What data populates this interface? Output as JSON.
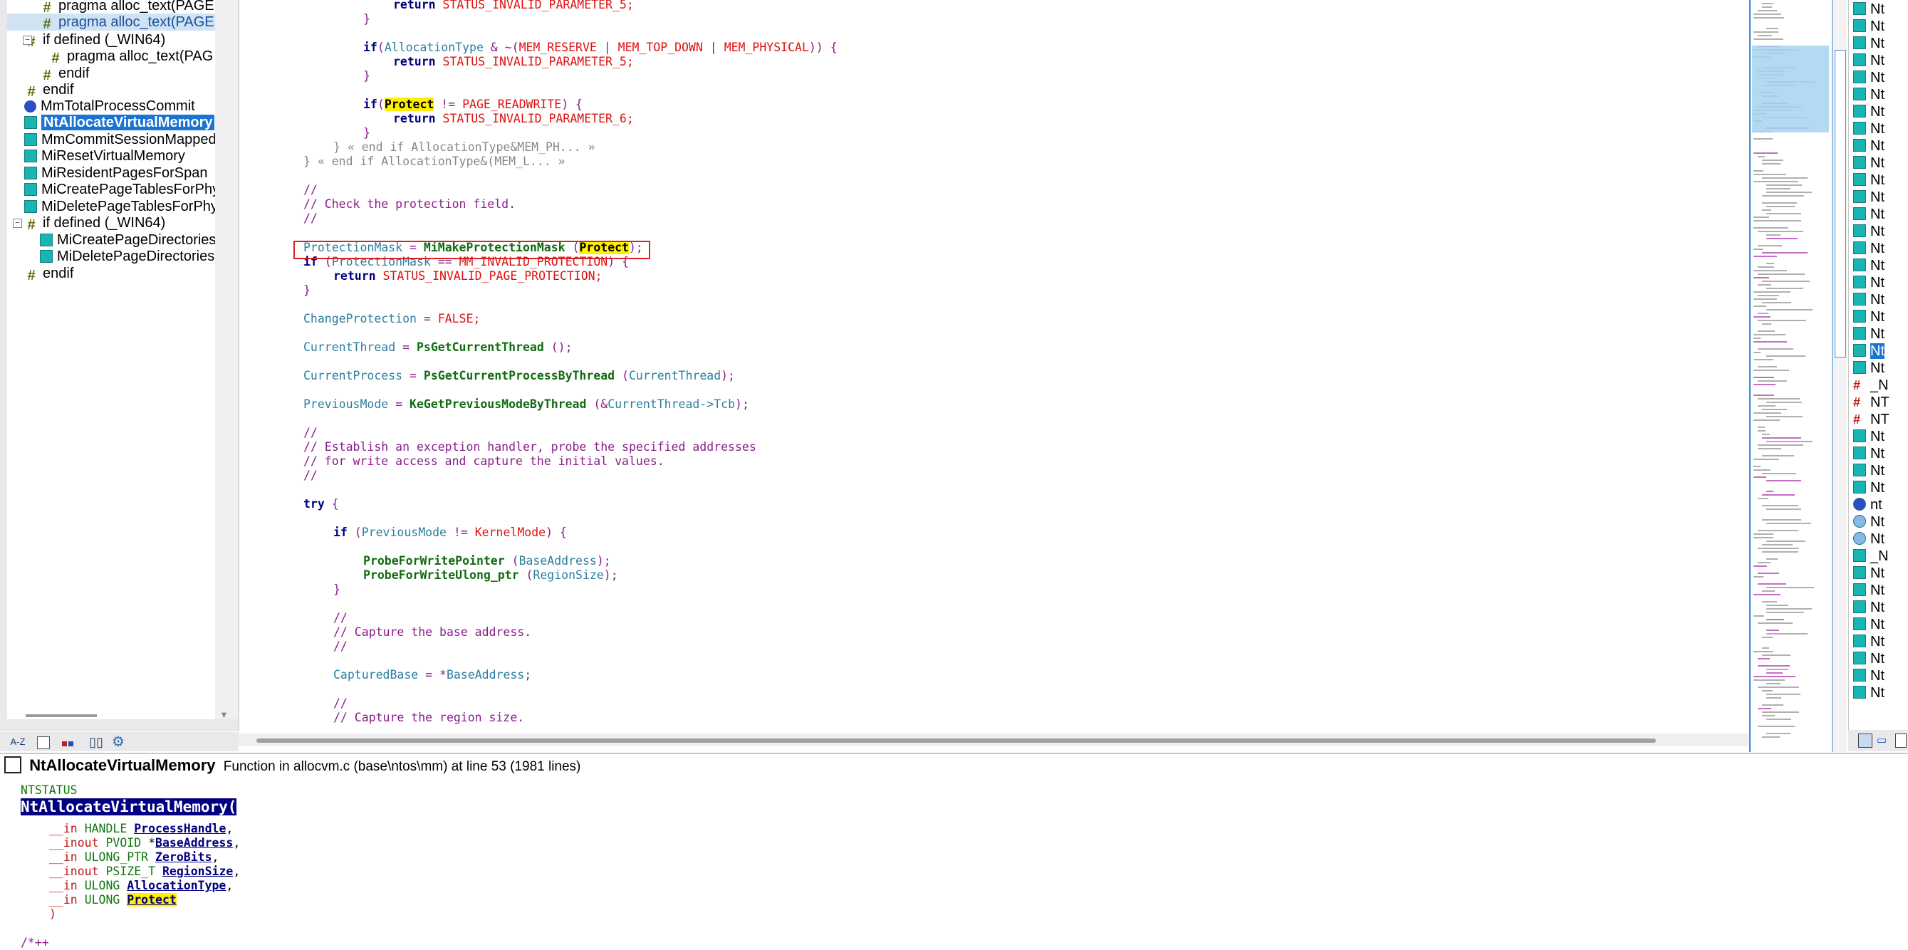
{
  "tree": {
    "items": [
      {
        "label": "pragma alloc_text(PAGE,M",
        "icon": "hash-icon",
        "expander": ""
      },
      {
        "label": "pragma alloc_text(PAGELK",
        "icon": "hash-icon",
        "expander": ""
      },
      {
        "label": "if defined (_WIN64)",
        "icon": "hash-icon",
        "expander": "−"
      },
      {
        "label": "pragma alloc_text(PAG",
        "icon": "hash-icon",
        "expander": ""
      },
      {
        "label": "endif",
        "icon": "hash-icon",
        "expander": ""
      },
      {
        "label": "endif",
        "icon": "hash-icon",
        "expander": ""
      },
      {
        "label": "MmTotalProcessCommit",
        "icon": "variable-icon",
        "expander": ""
      },
      {
        "label": "NtAllocateVirtualMemory",
        "icon": "function-icon",
        "expander": ""
      },
      {
        "label": "MmCommitSessionMappedV",
        "icon": "function-icon",
        "expander": ""
      },
      {
        "label": "MiResetVirtualMemory",
        "icon": "function-icon",
        "expander": ""
      },
      {
        "label": "MiResidentPagesForSpan",
        "icon": "function-icon",
        "expander": ""
      },
      {
        "label": "MiCreatePageTablesForPhys",
        "icon": "function-icon",
        "expander": ""
      },
      {
        "label": "MiDeletePageTablesForPhys",
        "icon": "function-icon",
        "expander": ""
      },
      {
        "label": "if defined (_WIN64)",
        "icon": "hash-icon",
        "expander": "−"
      },
      {
        "label": "MiCreatePageDirectoriesF",
        "icon": "function-icon",
        "expander": ""
      },
      {
        "label": "MiDeletePageDirectoriesF",
        "icon": "function-icon",
        "expander": ""
      },
      {
        "label": "endif",
        "icon": "hash-icon",
        "expander": ""
      }
    ],
    "toolbar": [
      "A-Z",
      "list",
      "categories",
      "book",
      "settings"
    ]
  },
  "code": {
    "lines": {
      "l0_return": "return",
      "l0_status": "STATUS_INVALID_PARAMETER_5;",
      "brace": "}",
      "l2_if": "if",
      "l2_open": "(",
      "l2_alloc": "AllocationType",
      "l2_amp": " & ~(",
      "l2_reserve": "MEM_RESERVE",
      "l2_pipe1": " | ",
      "l2_topdown": "MEM_TOP_DOWN",
      "l2_pipe2": " | ",
      "l2_physical": "MEM_PHYSICAL",
      "l2_close": ")) {",
      "l3_status": "STATUS_INVALID_PARAMETER_5;",
      "l5_protect": "Protect",
      "l5_ne": " != ",
      "l5_readwrite": "PAGE_READWRITE",
      "l5_close": ") {",
      "l6_status": "STATUS_INVALID_PARAMETER_6;",
      "fold1": "} « end if AllocationType&MEM_PH... »",
      "fold2": "} « end if AllocationType&(MEM_L... »",
      "c1": "//",
      "c2": "// Check the protection field.",
      "c3": "//",
      "pm_var": "ProtectionMask",
      "pm_eq": " = ",
      "pm_fn": "MiMakeProtectionMask",
      "pm_open": " (",
      "pm_arg": "Protect",
      "pm_close": ");",
      "pm_if": "if",
      "pm_if_open": " (",
      "pm_if_var": "ProtectionMask",
      "pm_if_eq": " == ",
      "pm_if_mac": "MM_INVALID_PROTECTION",
      "pm_if_close": ") {",
      "pm_return": "return",
      "pm_status": "STATUS_INVALID_PAGE_PROTECTION;",
      "cp_var": "ChangeProtection",
      "cp_eq": " = ",
      "cp_val": "FALSE;",
      "ct_var": "CurrentThread",
      "ct_eq": " = ",
      "ct_fn": "PsGetCurrentThread",
      "ct_rest": " ();",
      "cpr_var": "CurrentProcess",
      "cpr_eq": " = ",
      "cpr_fn": "PsGetCurrentProcessByThread",
      "cpr_open": " (",
      "cpr_arg": "CurrentThread",
      "cpr_close": ");",
      "pv_var": "PreviousMode",
      "pv_eq": " = ",
      "pv_fn": "KeGetPreviousModeByThread",
      "pv_open": " (&",
      "pv_arg": "CurrentThread->Tcb",
      "pv_close": ");",
      "e1": "//",
      "e2": "// Establish an exception handler, probe the specified addresses",
      "e3": "// for write access and capture the initial values.",
      "e4": "//",
      "try_kw": "try",
      "try_brace": " {",
      "if2": "if",
      "if2_open": " (",
      "if2_var": "PreviousMode",
      "if2_ne": " != ",
      "if2_mac": "KernelMode",
      "if2_close": ") {",
      "pwp_fn": "ProbeForWritePointer",
      "pwp_open": " (",
      "pwp_arg": "BaseAddress",
      "pwp_close": ");",
      "pwu_fn": "ProbeForWriteUlong_ptr",
      "pwu_open": " (",
      "pwu_arg": "RegionSize",
      "pwu_close": ");",
      "b1": "//",
      "b2": "// Capture the base address.",
      "b3": "//",
      "cb_var": "CapturedBase",
      "cb_eq": " = *",
      "cb_arg": "BaseAddress",
      "cb_semi": ";",
      "r1": "//",
      "r2": "// Capture the region size."
    }
  },
  "right_list": {
    "items": [
      {
        "label": "Nt",
        "icon": "function-icon"
      },
      {
        "label": "Nt",
        "icon": "function-icon"
      },
      {
        "label": "Nt",
        "icon": "function-icon"
      },
      {
        "label": "Nt",
        "icon": "function-icon"
      },
      {
        "label": "Nt",
        "icon": "function-icon"
      },
      {
        "label": "Nt",
        "icon": "function-icon"
      },
      {
        "label": "Nt",
        "icon": "function-icon"
      },
      {
        "label": "Nt",
        "icon": "function-icon"
      },
      {
        "label": "Nt",
        "icon": "function-icon"
      },
      {
        "label": "Nt",
        "icon": "function-icon"
      },
      {
        "label": "Nt",
        "icon": "function-icon"
      },
      {
        "label": "Nt",
        "icon": "function-icon"
      },
      {
        "label": "Nt",
        "icon": "function-icon"
      },
      {
        "label": "Nt",
        "icon": "function-icon"
      },
      {
        "label": "Nt",
        "icon": "function-icon"
      },
      {
        "label": "Nt",
        "icon": "function-icon"
      },
      {
        "label": "Nt",
        "icon": "function-icon"
      },
      {
        "label": "Nt",
        "icon": "function-icon"
      },
      {
        "label": "Nt",
        "icon": "function-icon"
      },
      {
        "label": "Nt",
        "icon": "function-icon"
      },
      {
        "label": "Nt",
        "icon": "function-icon",
        "selected": true
      },
      {
        "label": "Nt",
        "icon": "function-icon"
      },
      {
        "label": "_N",
        "icon": "hash-icon"
      },
      {
        "label": "NT",
        "icon": "hash-icon"
      },
      {
        "label": "NT",
        "icon": "hash-icon"
      },
      {
        "label": "Nt",
        "icon": "function-icon"
      },
      {
        "label": "Nt",
        "icon": "function-icon"
      },
      {
        "label": "Nt",
        "icon": "function-icon"
      },
      {
        "label": "Nt",
        "icon": "function-icon"
      },
      {
        "label": "nt",
        "icon": "variable-icon"
      },
      {
        "label": "Nt",
        "icon": "variable-light-icon"
      },
      {
        "label": "Nt",
        "icon": "variable-light-icon"
      },
      {
        "label": "_N",
        "icon": "function-icon"
      },
      {
        "label": "Nt",
        "icon": "function-icon"
      },
      {
        "label": "Nt",
        "icon": "function-icon"
      },
      {
        "label": "Nt",
        "icon": "function-icon"
      },
      {
        "label": "Nt",
        "icon": "function-icon"
      },
      {
        "label": "Nt",
        "icon": "function-icon"
      },
      {
        "label": "Nt",
        "icon": "function-icon"
      },
      {
        "label": "Nt",
        "icon": "function-icon"
      },
      {
        "label": "Nt",
        "icon": "function-icon"
      }
    ]
  },
  "context": {
    "title_name": "NtAllocateVirtualMemory",
    "title_desc": "Function in allocvm.c (base\\ntos\\mm) at line 53 (1981 lines)",
    "ret_type": "NTSTATUS",
    "func_name": "NtAllocateVirtualMemory(",
    "params": [
      {
        "qual": "__in",
        "type": "HANDLE",
        "ptr": "",
        "name": "ProcessHandle",
        "sep": ","
      },
      {
        "qual": "__inout",
        "type": "PVOID",
        "ptr": "*",
        "name": "BaseAddress",
        "sep": ","
      },
      {
        "qual": "__in",
        "type": "ULONG_PTR",
        "ptr": "",
        "name": "ZeroBits",
        "sep": ","
      },
      {
        "qual": "__inout",
        "type": "PSIZE_T",
        "ptr": "",
        "name": "RegionSize",
        "sep": ","
      },
      {
        "qual": "__in",
        "type": "ULONG",
        "ptr": "",
        "name": "AllocationType",
        "sep": ","
      },
      {
        "qual": "__in",
        "type": "ULONG",
        "ptr": "",
        "name": "Protect",
        "sep": ""
      }
    ],
    "close_paren": ")",
    "trailing_comment": "/*++"
  }
}
